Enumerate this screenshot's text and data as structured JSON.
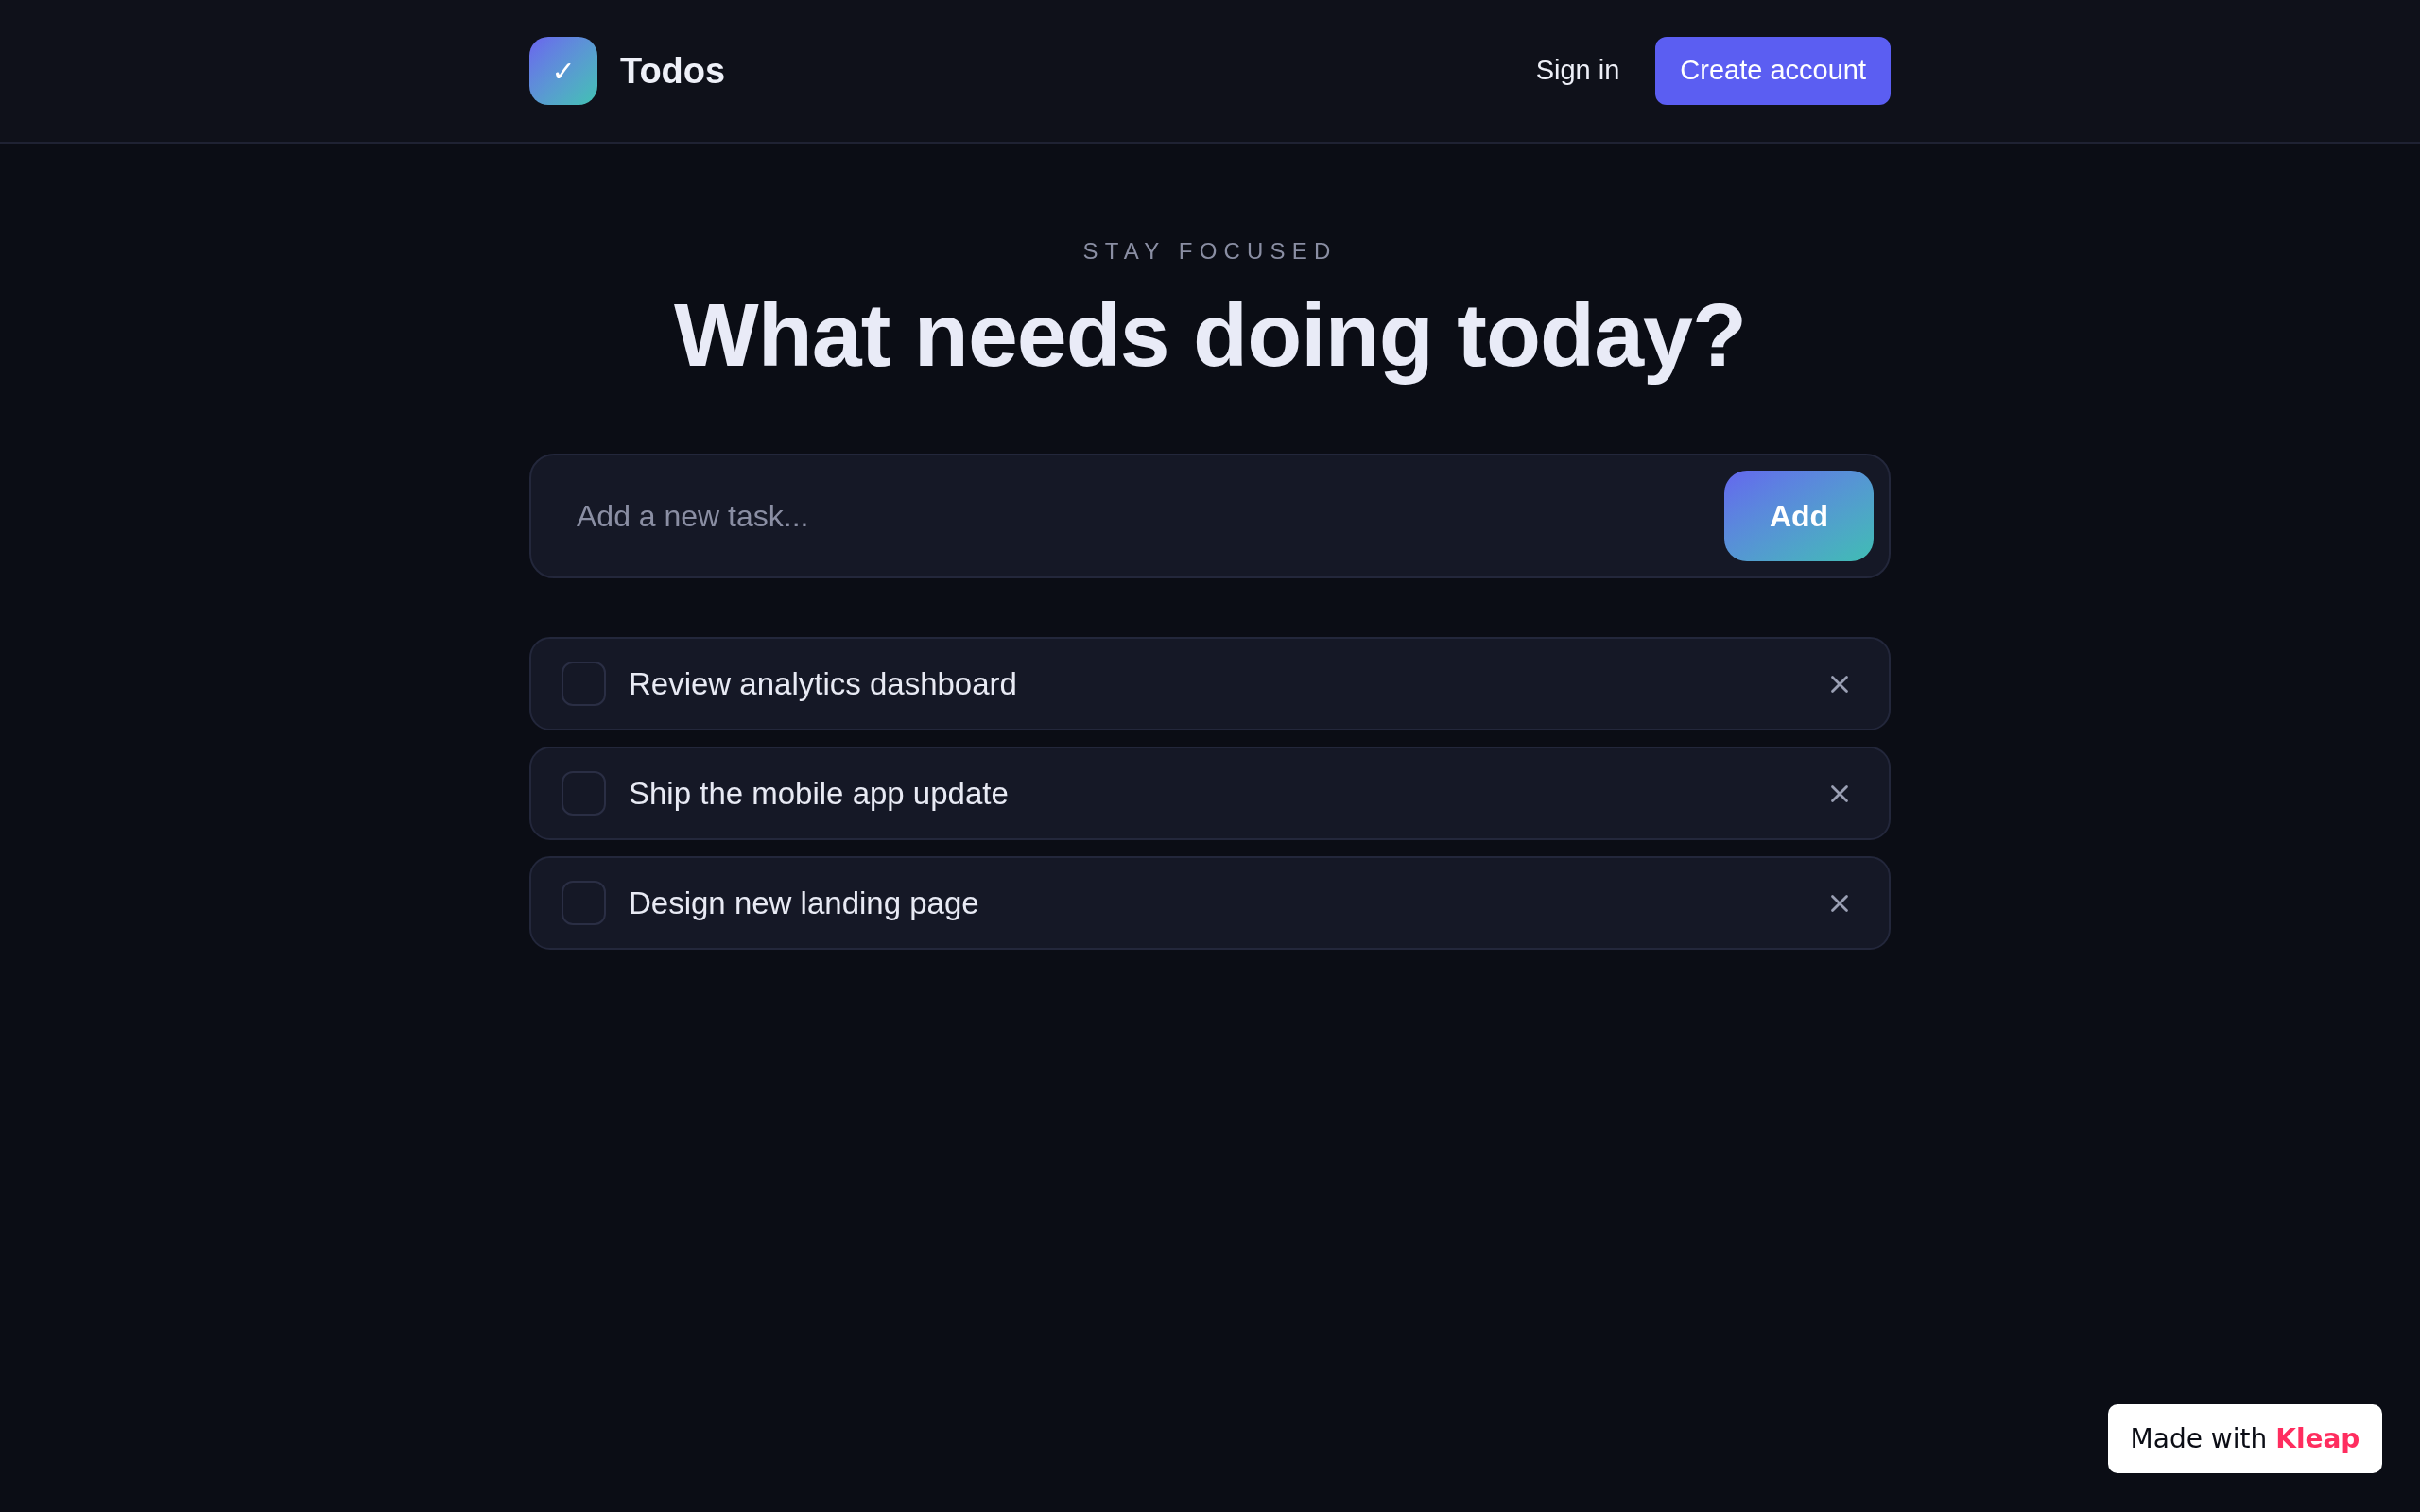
{
  "header": {
    "brand": {
      "logo_mark": "✓",
      "name": "Todos"
    },
    "nav": [
      {
        "kind": "link",
        "label": "Sign in"
      },
      {
        "kind": "button",
        "label": "Create account"
      }
    ]
  },
  "hero": {
    "eyebrow": "STAY FOCUSED",
    "title": "What needs doing today?"
  },
  "new_task": {
    "placeholder": "Add a new task...",
    "button": "Add"
  },
  "tasks": [
    {
      "label": "Review analytics dashboard",
      "checked": false
    },
    {
      "label": "Ship the mobile app update",
      "checked": false
    },
    {
      "label": "Design new landing page",
      "checked": false
    }
  ],
  "footer_badge": {
    "text": "Made with",
    "brand": "Kleap"
  }
}
